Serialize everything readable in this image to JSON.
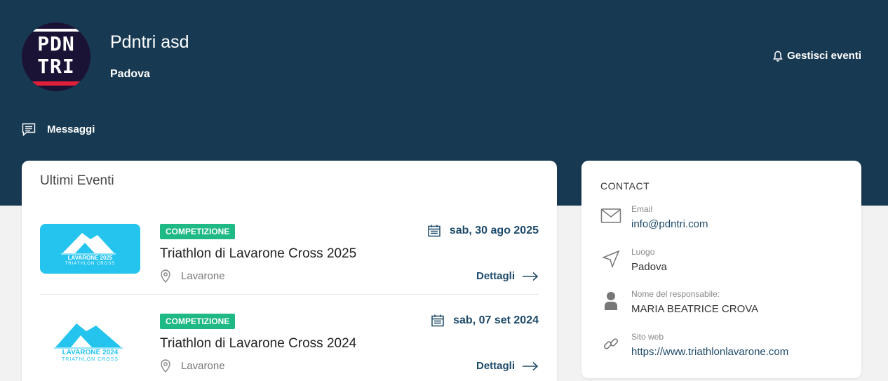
{
  "org": {
    "logo_line1": "PDN",
    "logo_line2": "TRI",
    "name": "Pdntri asd",
    "city": "Padova"
  },
  "header": {
    "manage_label": "Gestisci eventi",
    "messages_label": "Messaggi"
  },
  "events_section": {
    "title": "Ultimi Eventi",
    "items": [
      {
        "thumb_brand": "LAVARONE 2025",
        "thumb_sub": "TRIATHLON CROSS",
        "badge": "COMPETIZIONE",
        "date": "sab, 30 ago 2025",
        "title": "Triathlon di Lavarone Cross 2025",
        "place": "Lavarone",
        "details": "Dettagli"
      },
      {
        "thumb_brand": "LAVARONE 2024",
        "thumb_sub": "TRIATHLON CROSS",
        "badge": "COMPETIZIONE",
        "date": "sab, 07 set 2024",
        "title": "Triathlon di Lavarone Cross 2024",
        "place": "Lavarone",
        "details": "Dettagli"
      }
    ]
  },
  "contact": {
    "title": "CONTACT",
    "email_label": "Email",
    "email_value": "info@pdntri.com",
    "place_label": "Luogo",
    "place_value": "Padova",
    "manager_label": "Nome del responsabile:",
    "manager_value": "MARIA BEATRICE CROVA",
    "site_label": "Sito web",
    "site_value": "https://www.triathlonlavarone.com"
  },
  "colors": {
    "hero": "#183952",
    "accent": "#1d4a6a",
    "badge": "#1fb985",
    "brand_blue": "#24c4ef",
    "logo_red": "#e02039"
  },
  "icons": [
    "bell-icon",
    "chat-icon",
    "calendar-icon",
    "pin-icon",
    "arrow-right-icon",
    "mail-icon",
    "navigation-icon",
    "person-icon",
    "link-icon"
  ]
}
